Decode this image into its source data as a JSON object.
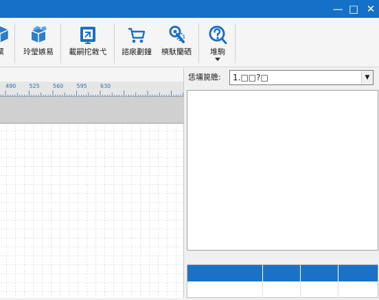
{
  "window": {
    "controls": {
      "minimize": "—",
      "maximize": "□",
      "close": "✕"
    }
  },
  "toolbar": {
    "buttons": [
      {
        "label": "襈",
        "icon": "box-icon"
      },
      {
        "label": "玲瑩嫉易",
        "icon": "package-icon"
      },
      {
        "label": "載嗣拕敹弋",
        "icon": "import-icon"
      },
      {
        "label": "諮扆劃鐘",
        "icon": "cart-icon"
      },
      {
        "label": "樉馱籣硒",
        "icon": "tools-icon"
      },
      {
        "label": "堆駒",
        "icon": "help-icon"
      }
    ]
  },
  "ruler": {
    "ticks": [
      "490",
      "525",
      "560",
      "595",
      "630"
    ]
  },
  "panel": {
    "label": "恁壎笢贍:",
    "selected_value": "1.□□?□"
  },
  "colors": {
    "titlebar": "#1570c8",
    "table_header": "#1a72c8",
    "icon_blue": "#1a6fc4"
  }
}
